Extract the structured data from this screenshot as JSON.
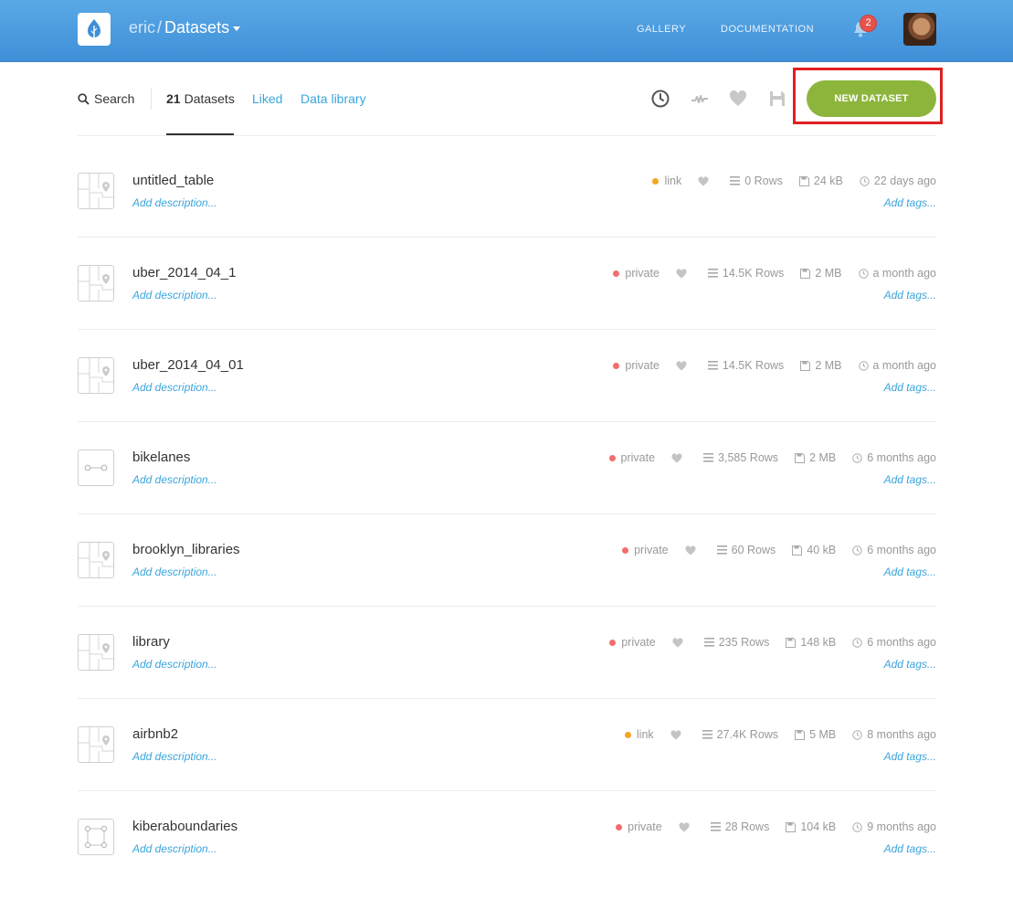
{
  "header": {
    "username": "eric",
    "separator": "/",
    "current_section": "Datasets",
    "nav": {
      "gallery": "GALLERY",
      "documentation": "DOCUMENTATION"
    },
    "notifications_count": "2"
  },
  "subheader": {
    "search_label": "Search",
    "datasets_count": "21",
    "datasets_label": "Datasets",
    "liked_label": "Liked",
    "library_label": "Data library",
    "new_dataset_label": "NEW DATASET"
  },
  "colors": {
    "header_blue": "#4a9ee0",
    "link_blue": "#3aa5dc",
    "new_button_green": "#8db53c",
    "private_red": "#f26d6d",
    "link_orange": "#f5a623",
    "highlight_red": "#e02020"
  },
  "datasets": [
    {
      "name": "untitled_table",
      "description": "Add description...",
      "privacy": "link",
      "rows": "0 Rows",
      "size": "24 kB",
      "updated": "22 days ago",
      "tags": "Add tags...",
      "thumb": "map-icon"
    },
    {
      "name": "uber_2014_04_1",
      "description": "Add description...",
      "privacy": "private",
      "rows": "14.5K Rows",
      "size": "2 MB",
      "updated": "a month ago",
      "tags": "Add tags...",
      "thumb": "map-icon"
    },
    {
      "name": "uber_2014_04_01",
      "description": "Add description...",
      "privacy": "private",
      "rows": "14.5K Rows",
      "size": "2 MB",
      "updated": "a month ago",
      "tags": "Add tags...",
      "thumb": "map-icon"
    },
    {
      "name": "bikelanes",
      "description": "Add description...",
      "privacy": "private",
      "rows": "3,585 Rows",
      "size": "2 MB",
      "updated": "6 months ago",
      "tags": "Add tags...",
      "thumb": "line-icon"
    },
    {
      "name": "brooklyn_libraries",
      "description": "Add description...",
      "privacy": "private",
      "rows": "60 Rows",
      "size": "40 kB",
      "updated": "6 months ago",
      "tags": "Add tags...",
      "thumb": "map-icon"
    },
    {
      "name": "library",
      "description": "Add description...",
      "privacy": "private",
      "rows": "235 Rows",
      "size": "148 kB",
      "updated": "6 months ago",
      "tags": "Add tags...",
      "thumb": "map-icon"
    },
    {
      "name": "airbnb2",
      "description": "Add description...",
      "privacy": "link",
      "rows": "27.4K Rows",
      "size": "5 MB",
      "updated": "8 months ago",
      "tags": "Add tags...",
      "thumb": "map-icon"
    },
    {
      "name": "kiberaboundaries",
      "description": "Add description...",
      "privacy": "private",
      "rows": "28 Rows",
      "size": "104 kB",
      "updated": "9 months ago",
      "tags": "Add tags...",
      "thumb": "polygon-icon"
    }
  ]
}
